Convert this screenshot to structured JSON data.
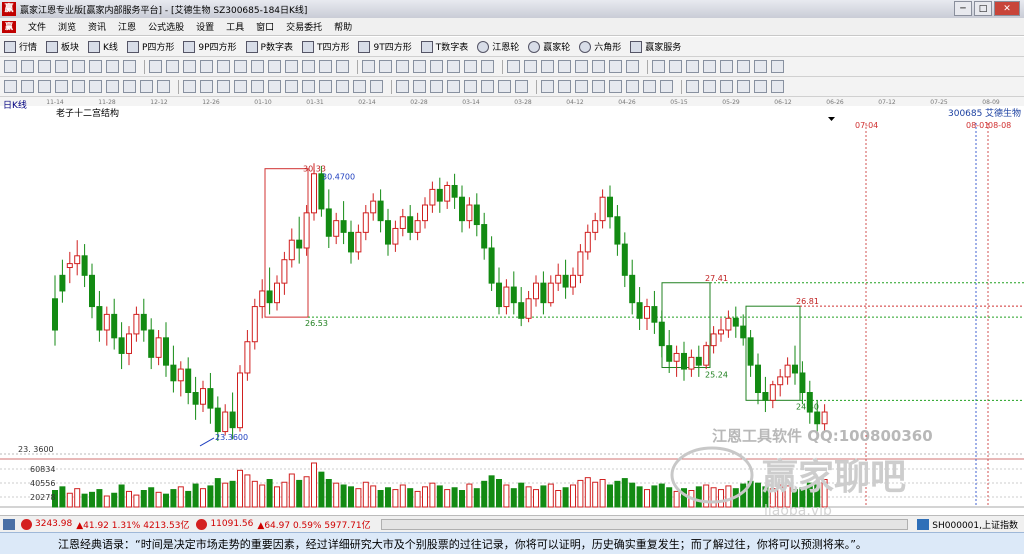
{
  "window": {
    "logo": "赢",
    "title": "赢家江恩专业版[赢家内部服务平台] - [艾德生物  SZ300685-184日K线]"
  },
  "menu": [
    "文件",
    "浏览",
    "资讯",
    "江恩",
    "公式选股",
    "设置",
    "工具",
    "窗口",
    "交易委托",
    "帮助"
  ],
  "toolbar1": [
    "行情",
    "板块",
    "K线",
    "P四方形",
    "9P四方形",
    "P数字表",
    "T四方形",
    "9T四方形",
    "T数字表",
    "江恩轮",
    "赢家轮",
    "六角形",
    "赢家服务"
  ],
  "chart": {
    "period_label": "日K线",
    "indicator_label": "老子十二宫结构",
    "stock_code": "300685",
    "stock_name": "艾德生物",
    "date_ticks": [
      "11-14",
      "11-28",
      "12-12",
      "12-26",
      "01-10",
      "01-31",
      "02-14",
      "02-28",
      "03-14",
      "03-28",
      "04-12",
      "04-26",
      "05-15",
      "05-29",
      "06-12",
      "06-26",
      "07-12",
      "07-25",
      "08-09"
    ],
    "high_label": "30.33",
    "high_value_label": "30.4700",
    "low_value_label": "23.3600",
    "axis_low": "23. 3600",
    "box_bottom_label": "26.53",
    "box2_top": "27.41",
    "box2_bottom": "25.24",
    "box3_top": "26.81",
    "box3_bottom": "24.40",
    "future_date_1": "07-04",
    "future_date_2": "08-01",
    "future_date_3": "08-08",
    "volume_ticks": [
      "60834",
      "40556",
      "20278"
    ],
    "watermark_main": "江恩工具软件  QQ:100800360",
    "watermark_brand": "赢家聊吧",
    "watermark_url": "liaoba.vip"
  },
  "chart_data": {
    "type": "candlestick",
    "ylim": [
      23.0,
      31.5
    ],
    "prices": [
      [
        27.0,
        27.6,
        26.2,
        25.8
      ],
      [
        27.6,
        28.0,
        27.2,
        26.9
      ],
      [
        27.8,
        28.2,
        27.9,
        27.4
      ],
      [
        27.9,
        28.5,
        28.1,
        27.6
      ],
      [
        28.1,
        28.4,
        27.6,
        27.3
      ],
      [
        27.6,
        27.9,
        26.8,
        26.5
      ],
      [
        26.8,
        27.2,
        26.2,
        25.9
      ],
      [
        26.2,
        26.8,
        26.6,
        25.8
      ],
      [
        26.6,
        27.0,
        26.0,
        25.7
      ],
      [
        26.0,
        26.4,
        25.6,
        25.2
      ],
      [
        25.6,
        26.3,
        26.1,
        25.3
      ],
      [
        26.1,
        26.8,
        26.6,
        25.9
      ],
      [
        26.6,
        27.0,
        26.2,
        25.9
      ],
      [
        26.2,
        26.5,
        25.5,
        25.2
      ],
      [
        25.5,
        26.2,
        26.0,
        25.3
      ],
      [
        26.0,
        26.4,
        25.3,
        25.0
      ],
      [
        25.3,
        25.8,
        24.9,
        24.6
      ],
      [
        24.9,
        25.4,
        25.2,
        24.5
      ],
      [
        25.2,
        25.5,
        24.6,
        24.3
      ],
      [
        24.6,
        25.0,
        24.3,
        23.9
      ],
      [
        24.3,
        24.9,
        24.7,
        24.1
      ],
      [
        24.7,
        25.1,
        24.2,
        23.8
      ],
      [
        24.2,
        24.5,
        23.6,
        23.36
      ],
      [
        23.6,
        24.3,
        24.1,
        23.5
      ],
      [
        24.1,
        24.6,
        23.7,
        23.4
      ],
      [
        23.7,
        25.3,
        25.1,
        23.6
      ],
      [
        25.1,
        26.2,
        25.9,
        24.9
      ],
      [
        25.9,
        27.0,
        26.8,
        25.7
      ],
      [
        26.8,
        27.5,
        27.2,
        26.5
      ],
      [
        27.2,
        27.8,
        26.9,
        26.6
      ],
      [
        26.9,
        27.6,
        27.4,
        26.7
      ],
      [
        27.4,
        28.2,
        28.0,
        27.1
      ],
      [
        28.0,
        28.8,
        28.5,
        27.8
      ],
      [
        28.5,
        29.1,
        28.3,
        27.9
      ],
      [
        28.3,
        29.4,
        29.2,
        28.1
      ],
      [
        29.2,
        30.47,
        30.2,
        29.0
      ],
      [
        30.2,
        30.4,
        29.3,
        29.1
      ],
      [
        29.3,
        29.8,
        28.6,
        28.3
      ],
      [
        28.6,
        29.2,
        29.0,
        28.4
      ],
      [
        29.0,
        29.5,
        28.7,
        28.4
      ],
      [
        28.7,
        29.0,
        28.2,
        27.9
      ],
      [
        28.2,
        28.9,
        28.7,
        28.0
      ],
      [
        28.7,
        29.4,
        29.2,
        28.5
      ],
      [
        29.2,
        29.7,
        29.5,
        29.0
      ],
      [
        29.5,
        29.8,
        29.0,
        28.7
      ],
      [
        29.0,
        29.3,
        28.4,
        28.1
      ],
      [
        28.4,
        29.0,
        28.8,
        28.2
      ],
      [
        28.8,
        29.3,
        29.1,
        28.6
      ],
      [
        29.1,
        29.4,
        28.7,
        28.5
      ],
      [
        28.7,
        29.2,
        29.0,
        28.5
      ],
      [
        29.0,
        29.6,
        29.4,
        28.8
      ],
      [
        29.4,
        30.0,
        29.8,
        29.2
      ],
      [
        29.8,
        30.1,
        29.5,
        29.2
      ],
      [
        29.5,
        30.0,
        29.9,
        29.3
      ],
      [
        29.9,
        30.2,
        29.6,
        29.3
      ],
      [
        29.6,
        29.9,
        29.0,
        28.7
      ],
      [
        29.0,
        29.6,
        29.4,
        28.8
      ],
      [
        29.4,
        29.7,
        28.9,
        28.6
      ],
      [
        28.9,
        29.2,
        28.3,
        28.0
      ],
      [
        28.3,
        28.6,
        27.4,
        27.2
      ],
      [
        27.4,
        27.8,
        26.8,
        26.6
      ],
      [
        26.8,
        27.5,
        27.3,
        26.6
      ],
      [
        27.3,
        27.7,
        26.9,
        26.6
      ],
      [
        26.9,
        27.3,
        26.5,
        26.3
      ],
      [
        26.5,
        27.2,
        27.0,
        26.4
      ],
      [
        27.0,
        27.6,
        27.4,
        26.8
      ],
      [
        27.4,
        27.7,
        26.9,
        26.6
      ],
      [
        26.9,
        27.6,
        27.4,
        26.8
      ],
      [
        27.4,
        27.9,
        27.6,
        27.2
      ],
      [
        27.6,
        28.0,
        27.3,
        27.0
      ],
      [
        27.3,
        27.8,
        27.6,
        27.1
      ],
      [
        27.6,
        28.4,
        28.2,
        27.4
      ],
      [
        28.2,
        28.9,
        28.7,
        28.0
      ],
      [
        28.7,
        29.2,
        29.0,
        28.5
      ],
      [
        29.0,
        29.8,
        29.6,
        28.8
      ],
      [
        29.6,
        29.9,
        29.1,
        28.8
      ],
      [
        29.1,
        29.4,
        28.4,
        28.1
      ],
      [
        28.4,
        28.7,
        27.6,
        27.3
      ],
      [
        27.6,
        28.0,
        26.9,
        26.6
      ],
      [
        26.9,
        27.3,
        26.5,
        26.2
      ],
      [
        26.5,
        27.0,
        26.8,
        26.2
      ],
      [
        26.8,
        27.2,
        26.4,
        26.1
      ],
      [
        26.4,
        26.7,
        25.8,
        25.5
      ],
      [
        25.8,
        26.2,
        25.4,
        25.1
      ],
      [
        25.4,
        25.8,
        25.6,
        25.0
      ],
      [
        25.6,
        25.9,
        25.2,
        24.9
      ],
      [
        25.2,
        25.7,
        25.5,
        25.0
      ],
      [
        25.5,
        25.8,
        25.3,
        25.0
      ],
      [
        25.3,
        25.9,
        25.8,
        25.2
      ],
      [
        25.8,
        26.3,
        26.1,
        25.6
      ],
      [
        26.1,
        26.5,
        26.2,
        25.9
      ],
      [
        26.2,
        26.7,
        26.5,
        26.0
      ],
      [
        26.5,
        26.8,
        26.3,
        26.0
      ],
      [
        26.3,
        26.6,
        26.0,
        25.8
      ],
      [
        26.0,
        26.2,
        25.3,
        25.0
      ],
      [
        25.3,
        25.6,
        24.6,
        24.3
      ],
      [
        24.6,
        25.0,
        24.4,
        24.1
      ],
      [
        24.4,
        24.9,
        24.8,
        24.2
      ],
      [
        24.8,
        25.2,
        25.0,
        24.5
      ],
      [
        25.0,
        25.5,
        25.3,
        24.8
      ],
      [
        25.3,
        25.8,
        25.1,
        24.8
      ],
      [
        25.1,
        25.4,
        24.6,
        24.3
      ],
      [
        24.6,
        24.9,
        24.1,
        23.8
      ],
      [
        24.1,
        24.4,
        23.8,
        23.6
      ],
      [
        23.8,
        24.3,
        24.1,
        23.6
      ]
    ],
    "volumes": [
      18,
      22,
      15,
      20,
      14,
      16,
      19,
      12,
      15,
      24,
      17,
      13,
      18,
      21,
      16,
      14,
      19,
      22,
      17,
      25,
      20,
      23,
      31,
      26,
      28,
      40,
      35,
      28,
      24,
      30,
      22,
      27,
      36,
      29,
      33,
      48,
      38,
      30,
      26,
      24,
      22,
      20,
      27,
      23,
      18,
      21,
      19,
      24,
      20,
      17,
      22,
      26,
      23,
      19,
      21,
      18,
      25,
      20,
      28,
      34,
      30,
      24,
      20,
      26,
      22,
      19,
      23,
      25,
      18,
      21,
      24,
      29,
      32,
      27,
      30,
      24,
      28,
      31,
      26,
      22,
      19,
      23,
      25,
      21,
      17,
      20,
      18,
      22,
      24,
      21,
      19,
      23,
      20,
      25,
      28,
      26,
      22,
      20,
      24,
      23,
      19,
      21,
      26,
      24,
      30
    ],
    "boxes": [
      {
        "label_top": "30.33",
        "label_bottom": "26.53",
        "top": 30.33,
        "bottom": 26.53,
        "color": "#d03030"
      },
      {
        "label_top": "27.41",
        "label_bottom": "25.24",
        "top": 27.41,
        "bottom": 25.24,
        "color": "#208020"
      },
      {
        "label_top": "26.81",
        "label_bottom": "24.40",
        "top": 26.81,
        "bottom": 24.4,
        "color": "#208020"
      }
    ]
  },
  "status": {
    "idx1": "3243.98",
    "idx1_change": "41.92 1.31% 4213.53亿",
    "idx2": "11091.56",
    "idx2_change": "64.97 0.59% 5977.71亿",
    "market_code": "SH000001,上证指数"
  },
  "quote": "江恩经典语录：“时间是决定市场走势的重要因素，经过详细研究大市及个别股票的过往记录，你将可以证明，历史确实重复发生；而了解过往，你将可以预测将来。”。"
}
